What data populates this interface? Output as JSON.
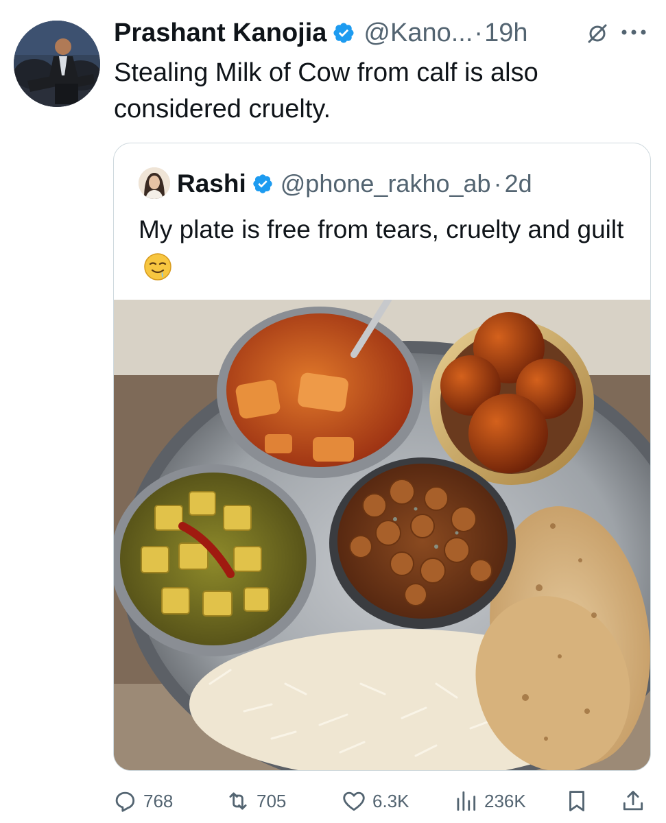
{
  "tweet": {
    "author_name": "Prashant Kanojia",
    "author_handle": "@Kano...",
    "separator": "·",
    "time": "19h",
    "text": "Stealing Milk of Cow from calf is also considered cruelty."
  },
  "quote": {
    "author_name": "Rashi",
    "author_handle": "@phone_rakho_ab",
    "separator": "·",
    "time": "2d",
    "text": "My plate is free from tears, cruelty and guilt",
    "emoji": "drooling-face"
  },
  "actions": {
    "replies": "768",
    "reposts": "705",
    "likes": "6.3K",
    "views": "236K"
  },
  "icons": {
    "verified": "verified-badge-icon",
    "grok": "grok-icon",
    "more": "more-icon",
    "reply": "reply-icon",
    "repost": "repost-icon",
    "like": "heart-icon",
    "views": "views-icon",
    "bookmark": "bookmark-icon",
    "share": "share-icon"
  },
  "colors": {
    "accent": "#1d9bf0",
    "text": "#0f1419",
    "muted": "#536471",
    "border": "#cfd9de"
  }
}
